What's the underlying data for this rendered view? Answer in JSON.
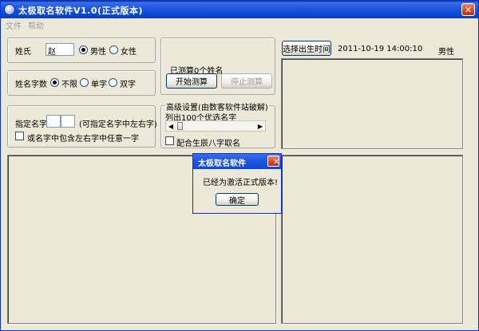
{
  "window": {
    "title": "太极取名软件V1.0(正式版本)"
  },
  "menu": {
    "items": [
      "文件",
      "帮助"
    ]
  },
  "surname": {
    "label": "姓氏",
    "value": "赵",
    "gender_male": "男性",
    "gender_female": "女性",
    "selected": "male"
  },
  "name_length": {
    "label": "姓名字数",
    "options": [
      "不限",
      "单字",
      "双字"
    ],
    "selected": 0
  },
  "specify": {
    "label": "指定名字",
    "hint": "(可指定名字中左右字)",
    "checkbox_label": "或名字中包含左右字中任意一字"
  },
  "measure": {
    "status": "已测算0个姓名",
    "start_button": "开始测算",
    "stop_button": "停止测算"
  },
  "advanced": {
    "title": "高级设置(由数客软件站破解)",
    "list_label": "列出100个优选名字",
    "bazi_label": "配合生辰八字取名"
  },
  "birth": {
    "button": "选择出生时间",
    "datetime": "2011-10-19 14:00:10",
    "gender": "男性"
  },
  "dialog": {
    "title": "太极取名软件",
    "message": "已经为激活正式版本!",
    "ok_button": "确定"
  },
  "colors": {
    "titlebar": "#2258E0",
    "face": "#ECE9D8",
    "close": "#D4452A"
  }
}
